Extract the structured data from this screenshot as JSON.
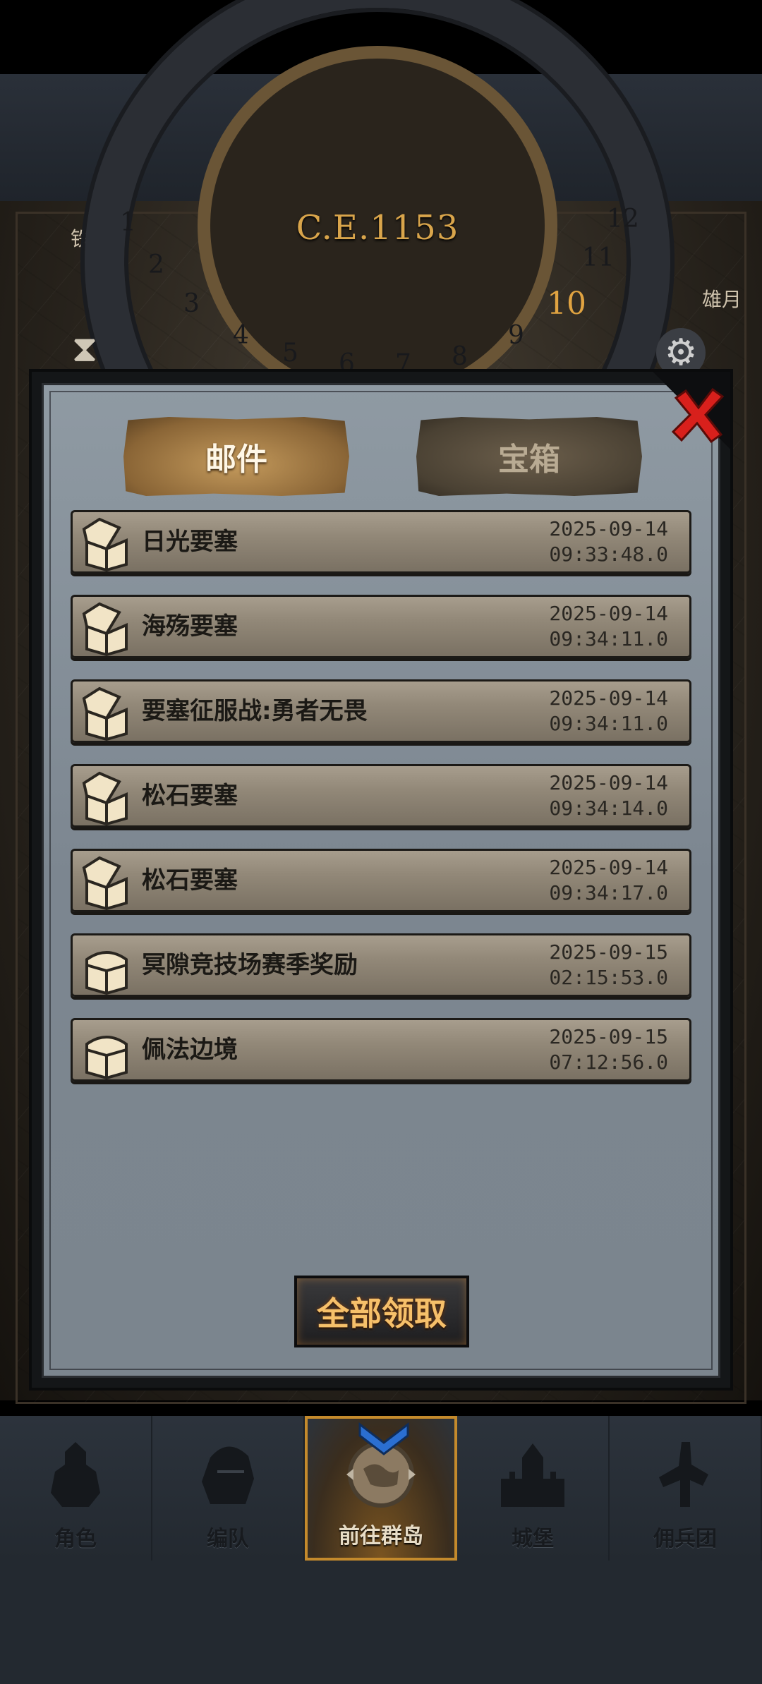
{
  "calendar": {
    "year": "C.E.1153",
    "numbers": [
      "1",
      "2",
      "3",
      "4",
      "5",
      "6",
      "7",
      "8",
      "9",
      "10",
      "11",
      "12"
    ],
    "active_number": "10"
  },
  "map": {
    "label_left": "铁",
    "label_right": "雄月"
  },
  "tabs": {
    "mail": "邮件",
    "chest": "宝箱"
  },
  "mails": [
    {
      "title": "日光要塞",
      "date": "2025-09-14",
      "time": "09:33:48.0",
      "chest": "open"
    },
    {
      "title": "海殇要塞",
      "date": "2025-09-14",
      "time": "09:34:11.0",
      "chest": "open"
    },
    {
      "title": "要塞征服战:勇者无畏",
      "date": "2025-09-14",
      "time": "09:34:11.0",
      "chest": "open"
    },
    {
      "title": "松石要塞",
      "date": "2025-09-14",
      "time": "09:34:14.0",
      "chest": "open"
    },
    {
      "title": "松石要塞",
      "date": "2025-09-14",
      "time": "09:34:17.0",
      "chest": "open"
    },
    {
      "title": "冥隙竞技场赛季奖励",
      "date": "2025-09-15",
      "time": "02:15:53.0",
      "chest": "closed"
    },
    {
      "title": "佩法边境",
      "date": "2025-09-15",
      "time": "07:12:56.0",
      "chest": "closed"
    }
  ],
  "claim_all_label": "全部领取",
  "nav": [
    {
      "label": "角色",
      "icon": "knight-icon",
      "active": false
    },
    {
      "label": "编队",
      "icon": "helmet-icon",
      "active": false
    },
    {
      "label": "前往群岛",
      "icon": "globe-icon",
      "active": true
    },
    {
      "label": "城堡",
      "icon": "castle-icon",
      "active": false
    },
    {
      "label": "佣兵团",
      "icon": "mercenary-icon",
      "active": false
    }
  ],
  "colors": {
    "accent_gold": "#d9a54b",
    "close_red": "#d8201c",
    "claim_text": "#f6c06a"
  }
}
